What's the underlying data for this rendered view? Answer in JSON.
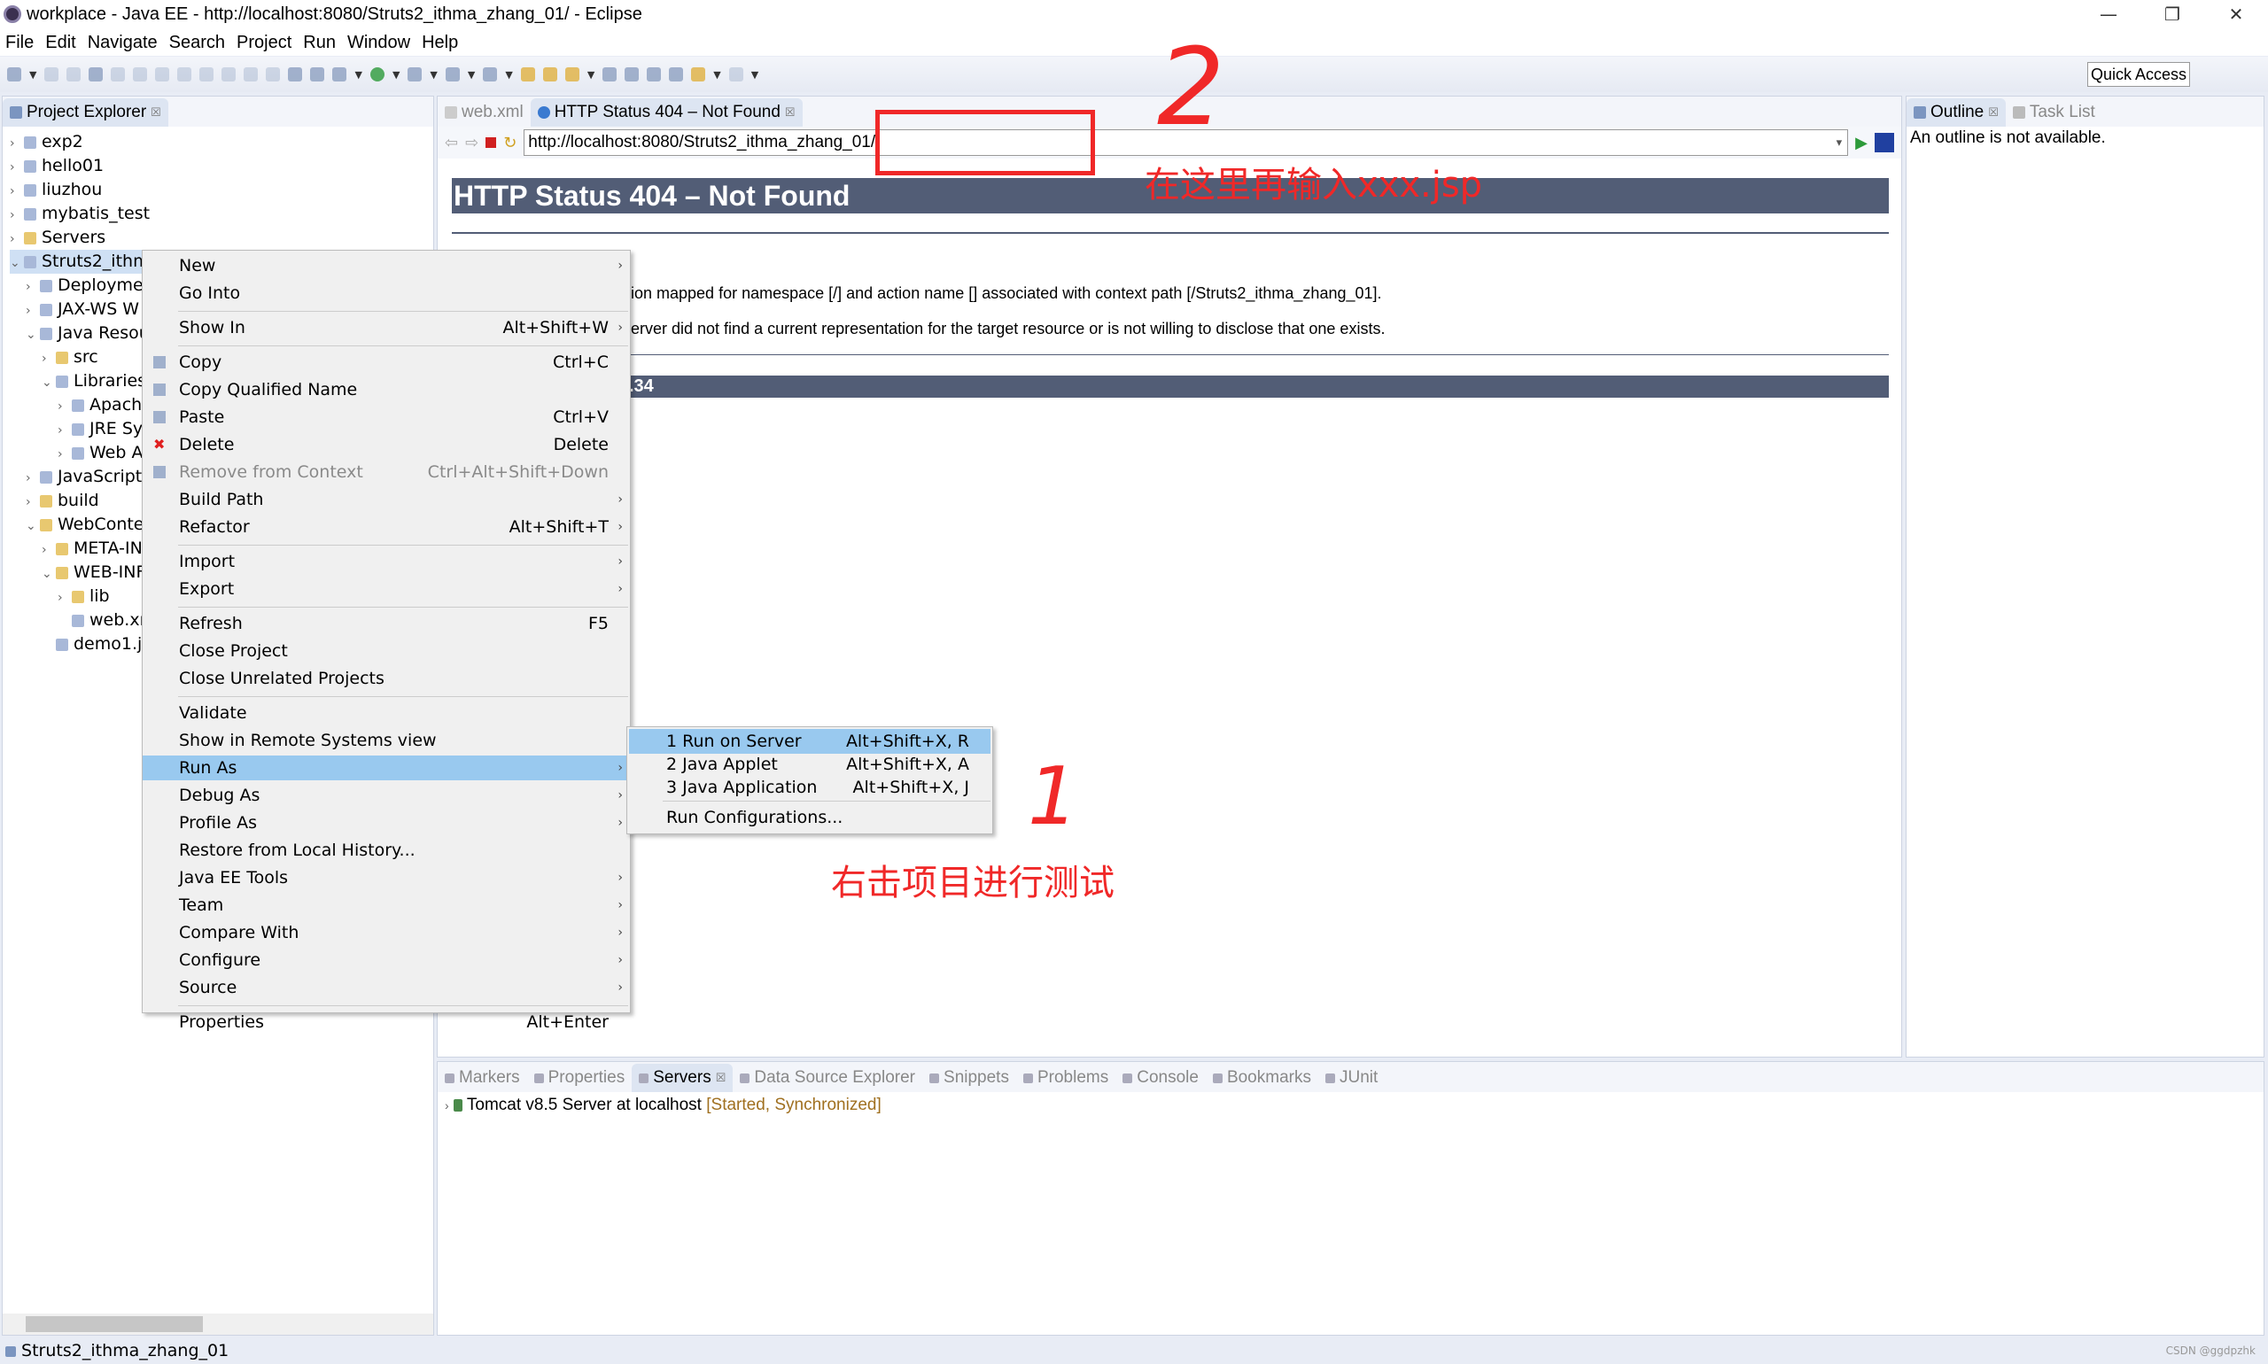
{
  "window": {
    "title": "workplace - Java EE - http://localhost:8080/Struts2_ithma_zhang_01/ - Eclipse",
    "minimize": "—",
    "restore": "❐",
    "close": "✕"
  },
  "menubar": [
    "File",
    "Edit",
    "Navigate",
    "Search",
    "Project",
    "Run",
    "Window",
    "Help"
  ],
  "toolbar": {
    "quick_access": "Quick Access"
  },
  "project_explorer": {
    "tab": "Project Explorer",
    "close": "☒",
    "tree": [
      {
        "label": "exp2",
        "depth": 0,
        "arrow": "›"
      },
      {
        "label": "hello01",
        "depth": 0,
        "arrow": "›"
      },
      {
        "label": "liuzhou",
        "depth": 0,
        "arrow": "›"
      },
      {
        "label": "mybatis_test",
        "depth": 0,
        "arrow": "›"
      },
      {
        "label": "Servers",
        "depth": 0,
        "arrow": "›",
        "folder": true
      },
      {
        "label": "Struts2_ithm",
        "depth": 0,
        "arrow": "⌄",
        "selected": true
      },
      {
        "label": "Deployme",
        "depth": 1,
        "arrow": "›"
      },
      {
        "label": "JAX-WS W",
        "depth": 1,
        "arrow": "›"
      },
      {
        "label": "Java Resou",
        "depth": 1,
        "arrow": "⌄"
      },
      {
        "label": "src",
        "depth": 2,
        "arrow": "›",
        "folder": true
      },
      {
        "label": "Libraries",
        "depth": 2,
        "arrow": "⌄"
      },
      {
        "label": "Apach",
        "depth": 3,
        "arrow": "›"
      },
      {
        "label": "JRE Sy",
        "depth": 3,
        "arrow": "›"
      },
      {
        "label": "Web A",
        "depth": 3,
        "arrow": "›"
      },
      {
        "label": "JavaScript",
        "depth": 1,
        "arrow": "›"
      },
      {
        "label": "build",
        "depth": 1,
        "arrow": "›",
        "folder": true
      },
      {
        "label": "WebConte",
        "depth": 1,
        "arrow": "⌄",
        "folder": true
      },
      {
        "label": "META-IN",
        "depth": 2,
        "arrow": "›",
        "folder": true
      },
      {
        "label": "WEB-INF",
        "depth": 2,
        "arrow": "⌄",
        "folder": true
      },
      {
        "label": "lib",
        "depth": 3,
        "arrow": "›",
        "folder": true
      },
      {
        "label": "web.xml",
        "depth": 3,
        "arrow": ""
      },
      {
        "label": "demo1.j",
        "depth": 2,
        "arrow": ""
      }
    ]
  },
  "editor": {
    "tabs": [
      {
        "label": "web.xml",
        "active": false
      },
      {
        "label": "HTTP Status 404 – Not Found",
        "active": true
      }
    ],
    "url": "http://localhost:8080/Struts2_ithma_zhang_01/",
    "page_title": "HTTP Status 404 – Not Found",
    "line1": "ion mapped for namespace [/] and action name [] associated with context path [/Struts2_ithma_zhang_01].",
    "line2": "erver did not find a current representation for the target resource or is not willing to disclose that one exists.",
    "footer": ".34"
  },
  "outline": {
    "tabs": [
      "Outline",
      "Task List"
    ],
    "message": "An outline is not available."
  },
  "bottom": {
    "tabs": [
      "Markers",
      "Properties",
      "Servers",
      "Data Source Explorer",
      "Snippets",
      "Problems",
      "Console",
      "Bookmarks",
      "JUnit"
    ],
    "active": "Servers",
    "server": "Tomcat v8.5 Server at localhost",
    "server_state": "[Started, Synchronized]"
  },
  "status": {
    "selection": "Struts2_ithma_zhang_01",
    "watermark": "CSDN @ggdpzhk"
  },
  "context_menu": [
    {
      "label": "New",
      "sub": true
    },
    {
      "label": "Go Into"
    },
    {
      "sep": true
    },
    {
      "label": "Show In",
      "shortcut": "Alt+Shift+W",
      "sub": true
    },
    {
      "sep": true
    },
    {
      "label": "Copy",
      "shortcut": "Ctrl+C",
      "icon": "copy-icon"
    },
    {
      "label": "Copy Qualified Name",
      "icon": "copy-qualified-icon"
    },
    {
      "label": "Paste",
      "shortcut": "Ctrl+V",
      "icon": "paste-icon"
    },
    {
      "label": "Delete",
      "shortcut": "Delete",
      "icon": "delete-icon"
    },
    {
      "label": "Remove from Context",
      "shortcut": "Ctrl+Alt+Shift+Down",
      "disabled": true,
      "icon": "remove-context-icon"
    },
    {
      "label": "Build Path",
      "sub": true
    },
    {
      "label": "Refactor",
      "shortcut": "Alt+Shift+T",
      "sub": true
    },
    {
      "sep": true
    },
    {
      "label": "Import",
      "sub": true
    },
    {
      "label": "Export",
      "sub": true
    },
    {
      "sep": true
    },
    {
      "label": "Refresh",
      "shortcut": "F5"
    },
    {
      "label": "Close Project"
    },
    {
      "label": "Close Unrelated Projects"
    },
    {
      "sep": true
    },
    {
      "label": "Validate"
    },
    {
      "label": "Show in Remote Systems view"
    },
    {
      "label": "Run As",
      "sub": true,
      "highlighted": true
    },
    {
      "label": "Debug As",
      "sub": true
    },
    {
      "label": "Profile As",
      "sub": true
    },
    {
      "label": "Restore from Local History..."
    },
    {
      "label": "Java EE Tools",
      "sub": true
    },
    {
      "label": "Team",
      "sub": true
    },
    {
      "label": "Compare With",
      "sub": true
    },
    {
      "label": "Configure",
      "sub": true
    },
    {
      "label": "Source",
      "sub": true
    },
    {
      "sep": true
    },
    {
      "label": "Properties",
      "shortcut": "Alt+Enter"
    }
  ],
  "submenu": [
    {
      "label": "1 Run on Server",
      "shortcut": "Alt+Shift+X, R",
      "highlighted": true
    },
    {
      "label": "2 Java Applet",
      "shortcut": "Alt+Shift+X, A"
    },
    {
      "label": "3 Java Application",
      "shortcut": "Alt+Shift+X, J"
    },
    {
      "sep": true
    },
    {
      "label": "Run Configurations..."
    }
  ],
  "annotations": {
    "step2_number": "2",
    "step2_text": "在这里再输入xxx.jsp",
    "step1_number": "1",
    "step1_text": "右击项目进行测试",
    "color": "#f02828"
  }
}
